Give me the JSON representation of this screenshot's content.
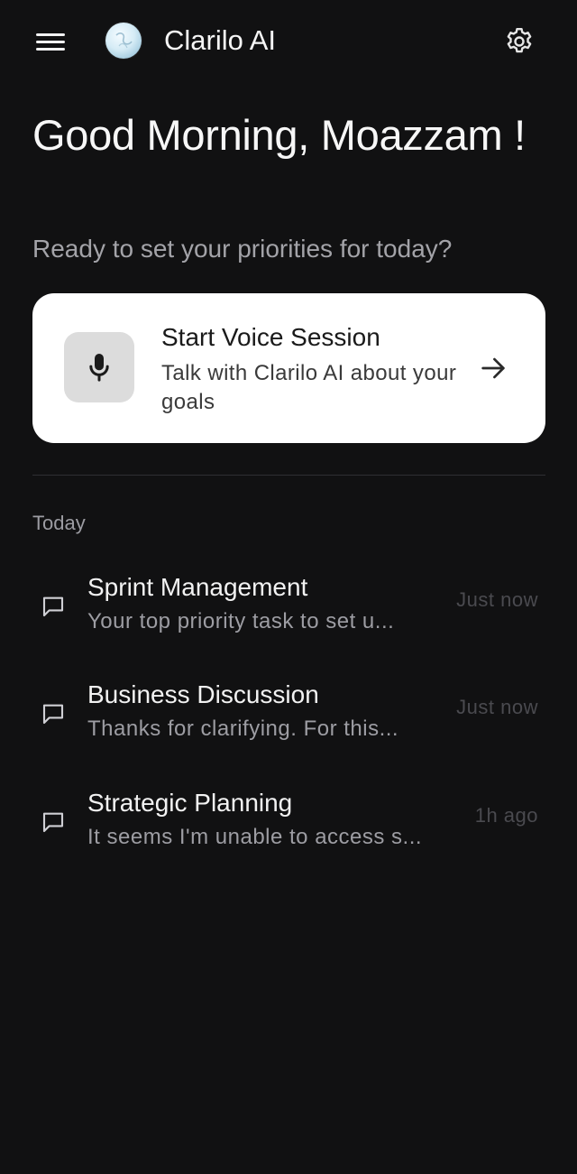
{
  "header": {
    "app_title": "Clarilo AI",
    "menu_icon": "hamburger-menu-icon",
    "logo_icon": "clarilo-logo-icon",
    "settings_icon": "gear-icon"
  },
  "greeting": {
    "title": "Good Morning, Moazzam !",
    "subtitle": "Ready to set your priorities for today?"
  },
  "voice_card": {
    "title": "Start Voice Session",
    "description": "Talk with Clarilo AI about your goals",
    "icon": "microphone-icon",
    "action_icon": "arrow-right-icon"
  },
  "history": {
    "section_label": "Today",
    "items": [
      {
        "title": "Sprint Management",
        "preview": "Your top priority task to set u...",
        "time": "Just now",
        "icon": "chat-bubble-icon"
      },
      {
        "title": "Business Discussion",
        "preview": "Thanks for clarifying. For this...",
        "time": "Just now",
        "icon": "chat-bubble-icon"
      },
      {
        "title": "Strategic Planning",
        "preview": "It seems I'm unable to access s...",
        "time": "1h ago",
        "icon": "chat-bubble-icon"
      }
    ]
  },
  "colors": {
    "background": "#111112",
    "card": "#ffffff",
    "text_primary": "#f2f2f2",
    "text_secondary": "#a3a3a8",
    "timestamp": "#4a4a4f"
  }
}
